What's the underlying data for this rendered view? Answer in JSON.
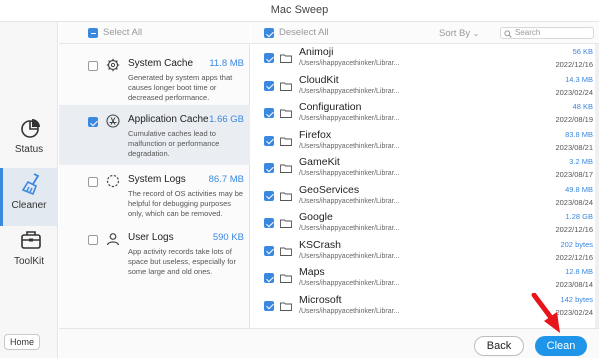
{
  "window": {
    "title": "Mac Sweep"
  },
  "sidebar": {
    "items": [
      {
        "label": "Status",
        "icon": "pie-chart-icon"
      },
      {
        "label": "Cleaner",
        "icon": "broom-icon"
      },
      {
        "label": "ToolKit",
        "icon": "toolbox-icon"
      }
    ],
    "home_label": "Home"
  },
  "categories": {
    "select_all_label": "Select All",
    "items": [
      {
        "name": "System Cache",
        "size": "11.8 MB",
        "checked": false,
        "desc": "Generated by system apps that causes longer boot time or decreased performance."
      },
      {
        "name": "Application Cache",
        "size": "1.66 GB",
        "checked": true,
        "desc": "Cumulative caches lead to malfunction or performance degradation."
      },
      {
        "name": "System Logs",
        "size": "86.7 MB",
        "checked": false,
        "desc": "The record of OS activities may be helpful for debugging purposes only, which can be removed."
      },
      {
        "name": "User Logs",
        "size": "590 KB",
        "checked": false,
        "desc": "App activity records take lots of space but useless, especially for some large and old ones."
      }
    ]
  },
  "files": {
    "deselect_all_label": "Deselect All",
    "sort_label": "Sort By",
    "search_placeholder": "Search",
    "rows": [
      {
        "name": "Animoji",
        "path": "/Users/ihappyacethinker/Librar...",
        "size": "56 KB",
        "date": "2022/12/16"
      },
      {
        "name": "CloudKit",
        "path": "/Users/ihappyacethinker/Librar...",
        "size": "14.3 MB",
        "date": "2023/02/24"
      },
      {
        "name": "Configuration",
        "path": "/Users/ihappyacethinker/Librar...",
        "size": "48 KB",
        "date": "2022/08/19"
      },
      {
        "name": "Firefox",
        "path": "/Users/ihappyacethinker/Librar...",
        "size": "83.8 MB",
        "date": "2023/08/21"
      },
      {
        "name": "GameKit",
        "path": "/Users/ihappyacethinker/Librar...",
        "size": "3.2 MB",
        "date": "2023/08/17"
      },
      {
        "name": "GeoServices",
        "path": "/Users/ihappyacethinker/Librar...",
        "size": "49.8 MB",
        "date": "2023/08/24"
      },
      {
        "name": "Google",
        "path": "/Users/ihappyacethinker/Librar...",
        "size": "1.28 GB",
        "date": "2022/12/16"
      },
      {
        "name": "KSCrash",
        "path": "/Users/ihappyacethinker/Librar...",
        "size": "202 bytes",
        "date": "2022/12/16"
      },
      {
        "name": "Maps",
        "path": "/Users/ihappyacethinker/Librar...",
        "size": "12.8 MB",
        "date": "2023/08/14"
      },
      {
        "name": "Microsoft",
        "path": "/Users/ihappyacethinker/Librar...",
        "size": "142 bytes",
        "date": "2023/02/24"
      }
    ]
  },
  "actions": {
    "back_label": "Back",
    "clean_label": "Clean"
  },
  "colors": {
    "accent": "#3a88e0",
    "clean_button": "#1e95e8",
    "arrow": "#e8141c"
  }
}
